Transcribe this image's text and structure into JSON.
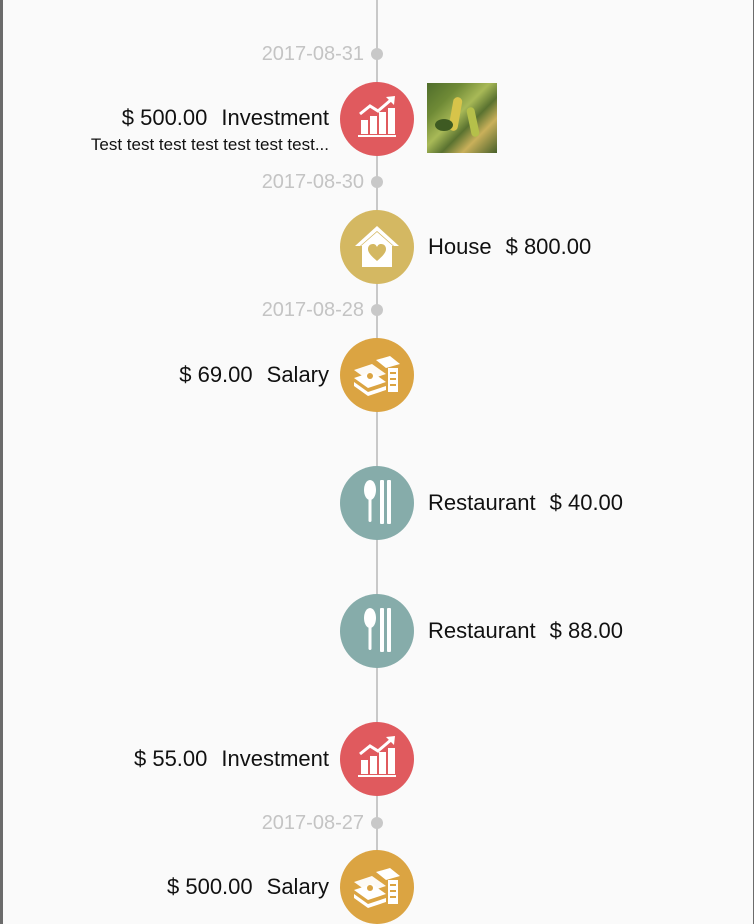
{
  "colors": {
    "investment": "#e05a5e",
    "house": "#d4b862",
    "salary": "#dba442",
    "restaurant": "#86acaa",
    "timeline": "#c8c8c8",
    "date_text": "#c4c4c4"
  },
  "timeline": {
    "dates": [
      "2017-08-31",
      "2017-08-30",
      "2017-08-28",
      "2017-08-27"
    ],
    "entries": [
      {
        "category": "Investment",
        "amount": "$ 500.00",
        "note": "Test test test test test test test...",
        "icon": "chart-up-icon",
        "has_photo": true
      },
      {
        "category": "House",
        "amount": "$ 800.00",
        "icon": "house-heart-icon"
      },
      {
        "category": "Salary",
        "amount": "$ 69.00",
        "icon": "money-stack-icon"
      },
      {
        "category": "Restaurant",
        "amount": "$ 40.00",
        "icon": "spoon-chopsticks-icon"
      },
      {
        "category": "Restaurant",
        "amount": "$ 88.00",
        "icon": "spoon-chopsticks-icon"
      },
      {
        "category": "Investment",
        "amount": "$ 55.00",
        "icon": "chart-up-icon"
      },
      {
        "category": "Salary",
        "amount": "$ 500.00",
        "icon": "money-stack-icon"
      }
    ]
  }
}
